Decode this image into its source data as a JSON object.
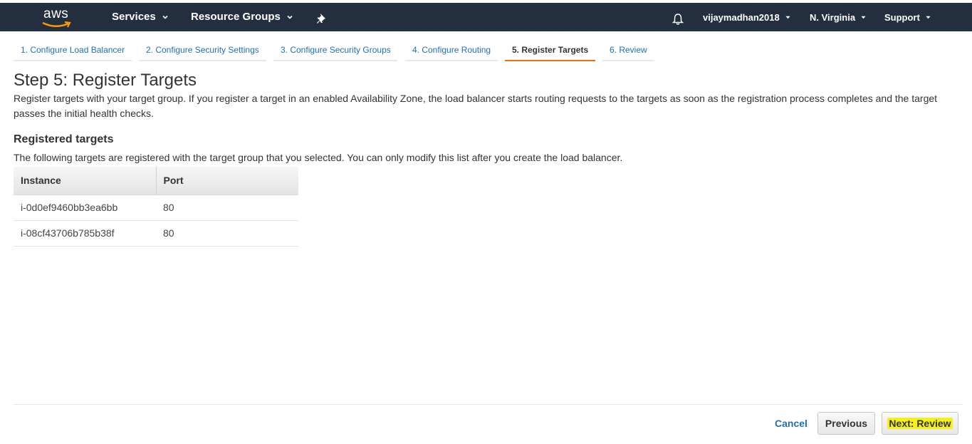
{
  "topnav": {
    "logo_text": "aws",
    "services_label": "Services",
    "resource_groups_label": "Resource Groups",
    "username": "vijaymadhan2018",
    "region": "N. Virginia",
    "support": "Support"
  },
  "tabs": [
    {
      "label": "1. Configure Load Balancer"
    },
    {
      "label": "2. Configure Security Settings"
    },
    {
      "label": "3. Configure Security Groups"
    },
    {
      "label": "4. Configure Routing"
    },
    {
      "label": "5. Register Targets"
    },
    {
      "label": "6. Review"
    }
  ],
  "page": {
    "title": "Step 5: Register Targets",
    "description": "Register targets with your target group. If you register a target in an enabled Availability Zone, the load balancer starts routing requests to the targets as soon as the registration process completes and the target passes the initial health checks.",
    "section_title": "Registered targets",
    "section_description": "The following targets are registered with the target group that you selected. You can only modify this list after you create the load balancer."
  },
  "table": {
    "headers": [
      "Instance",
      "Port"
    ],
    "rows": [
      [
        "i-0d0ef9460bb3ea6bb",
        "80"
      ],
      [
        "i-08cf43706b785b38f",
        "80"
      ]
    ]
  },
  "footer": {
    "cancel": "Cancel",
    "previous": "Previous",
    "next": "Next: Review"
  },
  "colors": {
    "nav_bg": "#232f3e",
    "link": "#1f6fb2",
    "active_tab_underline": "#ec7211",
    "highlight": "#f3f01a"
  },
  "icons": [
    "aws-logo",
    "chevron-down-icon",
    "pin-icon",
    "bell-icon"
  ]
}
